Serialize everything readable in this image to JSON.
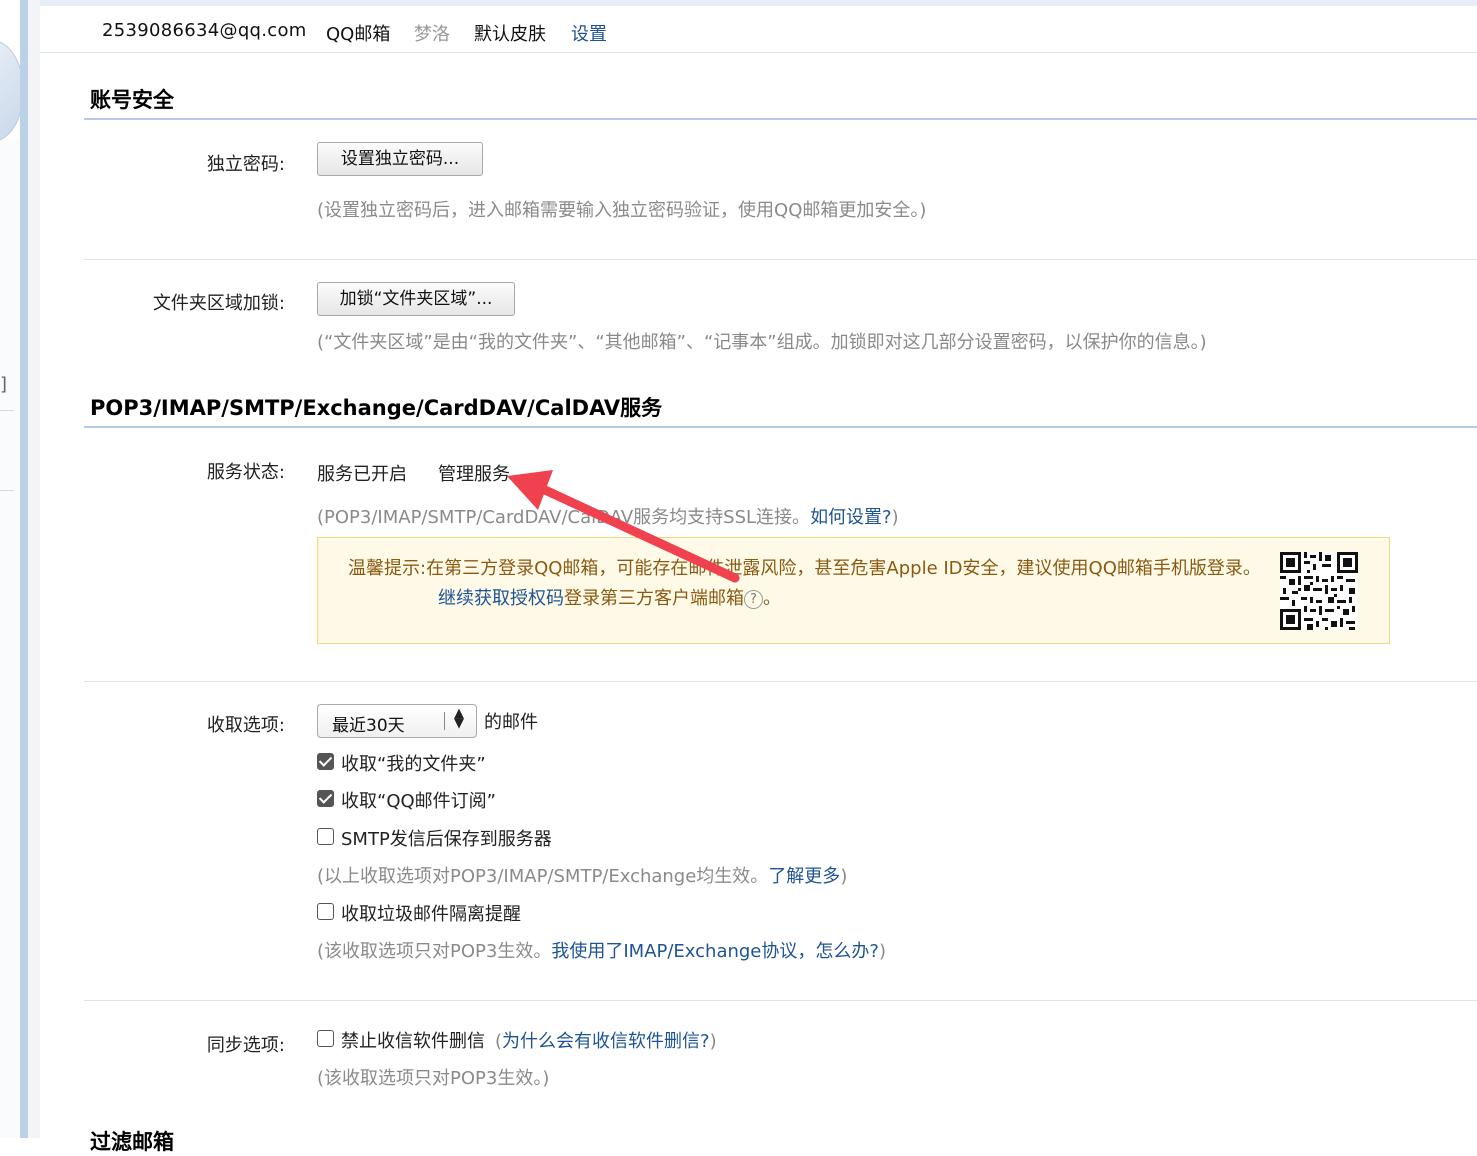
{
  "header": {
    "email": "2539086634@qq.com",
    "qq_mail": "QQ邮箱",
    "nickname": "梦洛",
    "skin": "默认皮肤",
    "settings": "设置"
  },
  "account_security": {
    "title": "账号安全",
    "password_label": "独立密码:",
    "password_button": "设置独立密码...",
    "password_hint": "(设置独立密码后，进入邮箱需要输入独立密码验证，使用QQ邮箱更加安全。)",
    "folder_lock_label": "文件夹区域加锁:",
    "folder_lock_button": "加锁“文件夹区域”...",
    "folder_lock_hint": "(“文件夹区域”是由“我的文件夹”、“其他邮箱”、“记事本”组成。加锁即对这几部分设置密码，以保护你的信息。)"
  },
  "services": {
    "title": "POP3/IMAP/SMTP/Exchange/CardDAV/CalDAV服务",
    "status_label": "服务状态:",
    "status_value": "服务已开启",
    "manage_link": "管理服务",
    "ssl_hint_prefix": "(POP3/IMAP/SMTP/CardDAV/CalDAV服务均支持SSL连接。",
    "ssl_hint_link": "如何设置?",
    "ssl_hint_suffix": ")",
    "warning": {
      "label": "温馨提示:",
      "text": "在第三方登录QQ邮箱，可能存在邮件泄露风险，甚至危害Apple ID安全，建议使用QQ邮箱手机版登录。",
      "link": "继续获取授权码",
      "link_suffix": "登录第三方客户端邮箱",
      "end": "。",
      "help_icon": "?"
    }
  },
  "receive": {
    "label": "收取选项:",
    "select_value": "最近30天",
    "select_suffix": "的邮件",
    "options": [
      {
        "label": "收取“我的文件夹”",
        "checked": true
      },
      {
        "label": "收取“QQ邮件订阅”",
        "checked": true
      },
      {
        "label": "SMTP发信后保存到服务器",
        "checked": false
      }
    ],
    "hint1_prefix": "(以上收取选项对POP3/IMAP/SMTP/Exchange均生效。",
    "hint1_link": "了解更多",
    "hint1_suffix": ")",
    "spam_option": {
      "label": "收取垃圾邮件隔离提醒",
      "checked": false
    },
    "hint2_prefix": "(该收取选项只对POP3生效。",
    "hint2_link": "我使用了IMAP/Exchange协议，怎么办?",
    "hint2_suffix": ")"
  },
  "sync": {
    "label": "同步选项:",
    "option": {
      "label": "禁止收信软件删信",
      "checked": false
    },
    "link_prefix": "(",
    "link": "为什么会有收信软件删信?",
    "link_suffix": ")",
    "hint": "(该收取选项只对POP3生效。)"
  },
  "next_section_title": "过滤邮箱",
  "left_bracket": "]",
  "colors": {
    "link": "#1e5494",
    "section_line": "#b7cbe8",
    "warning_bg": "#fffae8",
    "warning_text": "#8a5a12",
    "arrow": "#f0414f"
  }
}
